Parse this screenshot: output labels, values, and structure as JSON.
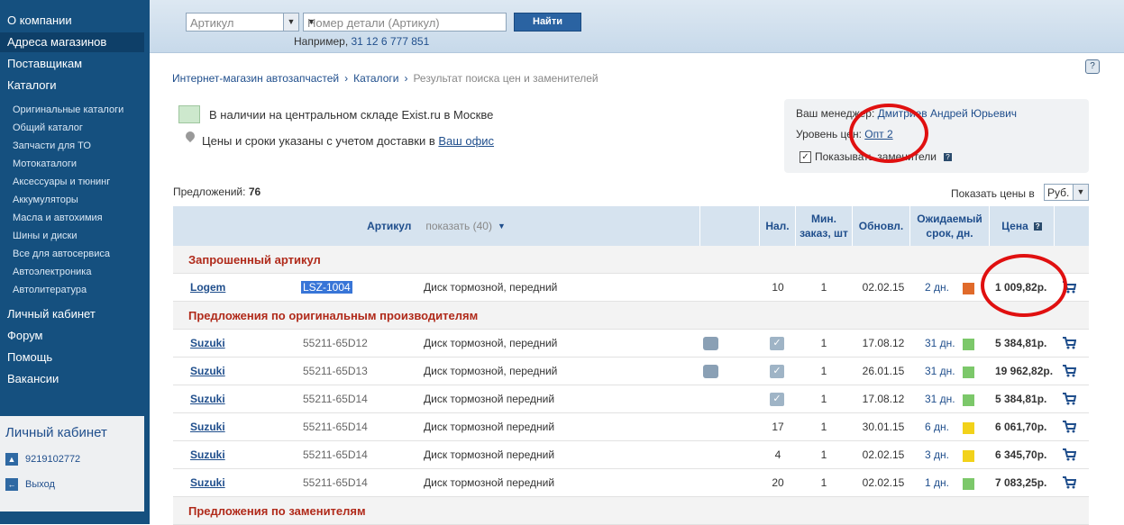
{
  "sidebar": {
    "main_items": [
      {
        "label": "О компании"
      },
      {
        "label": "Адреса магазинов"
      },
      {
        "label": "Поставщикам"
      },
      {
        "label": "Каталоги"
      }
    ],
    "sub_items": [
      {
        "label": "Оригинальные каталоги"
      },
      {
        "label": "Общий каталог"
      },
      {
        "label": "Запчасти для ТО"
      },
      {
        "label": "Мотокаталоги"
      },
      {
        "label": "Аксессуары и тюнинг"
      },
      {
        "label": "Аккумуляторы"
      },
      {
        "label": "Масла и автохимия"
      },
      {
        "label": "Шины и диски"
      },
      {
        "label": "Все для автосервиса"
      },
      {
        "label": "Автоэлектроника"
      },
      {
        "label": "Автолитература"
      }
    ],
    "bottom_items": [
      {
        "label": "Личный кабинет"
      },
      {
        "label": "Форум"
      },
      {
        "label": "Помощь"
      },
      {
        "label": "Вакансии"
      }
    ],
    "cabinet": {
      "title": "Личный кабинет",
      "account": "9219102772",
      "logout": "Выход"
    }
  },
  "search": {
    "type_value": "Артикул",
    "placeholder": "Номер детали (Артикул)",
    "button": "Найти",
    "example_prefix": "Например,",
    "example_value": "31 12 6 777 851"
  },
  "breadcrumb": {
    "items": [
      "Интернет-магазин автозапчастей",
      "Каталоги"
    ],
    "current": "Результат поиска цен и заменителей"
  },
  "legend": {
    "in_stock": "В наличии на центральном складе Exist.ru в Москве",
    "delivery_prefix": "Цены и сроки указаны с учетом доставки в",
    "delivery_link": "Ваш офис"
  },
  "manager": {
    "label": "Ваш менеджер:",
    "name": "Дмитриев Андрей Юрьевич",
    "level_label": "Уровень цен:",
    "level_value": "Опт 2",
    "show_subs": "Показывать заменители",
    "show_subs_checked": true
  },
  "offers": {
    "label": "Предложений:",
    "count": "76",
    "currency_label": "Показать цены в",
    "currency": "Руб."
  },
  "table": {
    "headers": {
      "article": "Артикул",
      "show": "показать (40)",
      "availability": "Нал.",
      "min_order": "Мин. заказ, шт",
      "updated": "Обновл.",
      "expected": "Ожидаемый срок, дн.",
      "price": "Цена"
    },
    "sections": {
      "requested": "Запрошенный артикул",
      "original": "Предложения по оригинальным производителям",
      "substitutes": "Предложения по заменителям"
    },
    "colors": {
      "orange": "#e06a2a",
      "green": "#7cc86a",
      "yellow": "#f2d21a"
    },
    "requested_row": {
      "brand": "Logem",
      "article": "LSZ-1004",
      "desc": "Диск тормозной, передний",
      "avail": "10",
      "min": "1",
      "updated": "02.02.15",
      "days": "2 дн.",
      "status": "orange",
      "price": "1 009,82р.",
      "car": false,
      "check": false
    },
    "rows": [
      {
        "brand": "Suzuki",
        "article": "55211-65D12",
        "desc": "Диск тормозной, передний",
        "avail": "",
        "min": "1",
        "updated": "17.08.12",
        "days": "31 дн.",
        "status": "green",
        "price": "5 384,81р.",
        "car": true,
        "check": true
      },
      {
        "brand": "Suzuki",
        "article": "55211-65D13",
        "desc": "Диск тормозной, передний",
        "avail": "",
        "min": "1",
        "updated": "26.01.15",
        "days": "31 дн.",
        "status": "green",
        "price": "19 962,82р.",
        "car": true,
        "check": true
      },
      {
        "brand": "Suzuki",
        "article": "55211-65D14",
        "desc": "Диск тормозной передний",
        "avail": "",
        "min": "1",
        "updated": "17.08.12",
        "days": "31 дн.",
        "status": "green",
        "price": "5 384,81р.",
        "car": false,
        "check": true
      },
      {
        "brand": "Suzuki",
        "article": "55211-65D14",
        "desc": "Диск тормозной передний",
        "avail": "17",
        "min": "1",
        "updated": "30.01.15",
        "days": "6 дн.",
        "status": "yellow",
        "price": "6 061,70р.",
        "car": false,
        "check": false
      },
      {
        "brand": "Suzuki",
        "article": "55211-65D14",
        "desc": "Диск тормозной передний",
        "avail": "4",
        "min": "1",
        "updated": "02.02.15",
        "days": "3 дн.",
        "status": "yellow",
        "price": "6 345,70р.",
        "car": false,
        "check": false
      },
      {
        "brand": "Suzuki",
        "article": "55211-65D14",
        "desc": "Диск тормозной передний",
        "avail": "20",
        "min": "1",
        "updated": "02.02.15",
        "days": "1 дн.",
        "status": "green",
        "price": "7 083,25р.",
        "car": false,
        "check": false
      }
    ]
  }
}
